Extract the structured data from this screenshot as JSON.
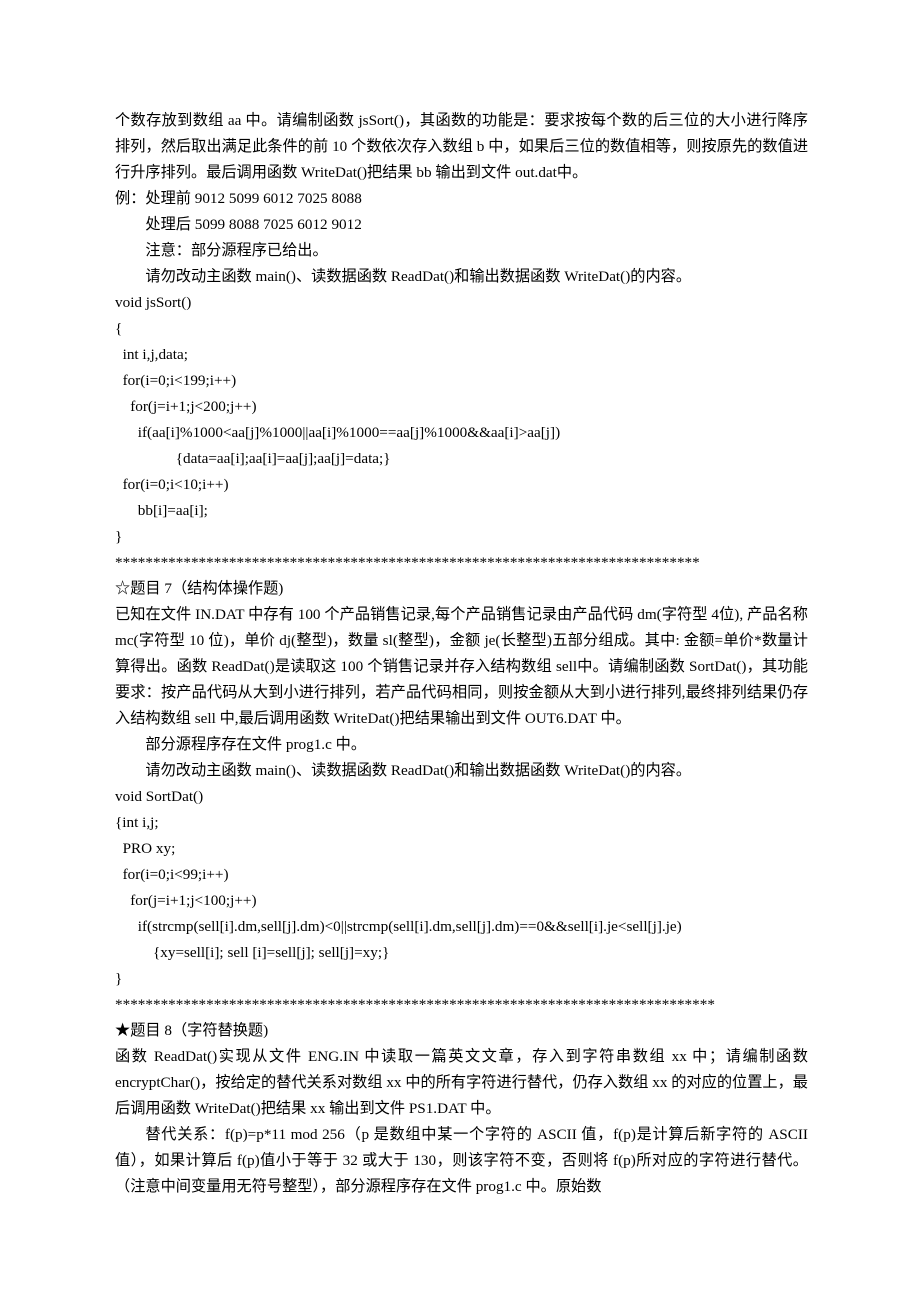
{
  "p_intro_1": "个数存放到数组 aa 中。请编制函数 jsSort()，其函数的功能是：要求按每个数的后三位的大小进行降序排列，然后取出满足此条件的前 10 个数依次存入数组 b 中，如果后三位的数值相等，则按原先的数值进行升序排列。最后调用函数 WriteDat()把结果 bb 输出到文件 out.dat中。",
  "p_example_line1": "例：处理前  9012 5099 6012 7025 8088",
  "p_example_line2": "处理后  5099 8088 7025 6012 9012",
  "p_note1": "注意：部分源程序已给出。",
  "p_note2": "请勿改动主函数 main()、读数据函数 ReadDat()和输出数据函数 WriteDat()的内容。",
  "code_block_1": "void jsSort()\n{\n  int i,j,data;\n  for(i=0;i<199;i++)\n    for(j=i+1;j<200;j++)\n      if(aa[i]%1000<aa[j]%1000||aa[i]%1000==aa[j]%1000&&aa[i]>aa[j])\n                {data=aa[i];aa[i]=aa[j];aa[j]=data;}\n  for(i=0;i<10;i++)\n      bb[i]=aa[i];\n}",
  "sep_1": "*****************************************************************************",
  "title_7": "☆题目 7（结构体操作题)",
  "p7_body": "已知在文件 IN.DAT 中存有 100 个产品销售记录,每个产品销售记录由产品代码 dm(字符型 4位), 产品名称 mc(字符型 10 位)，单价 dj(整型)，数量 sl(整型)，金额 je(长整型)五部分组成。其中: 金额=单价*数量计算得出。函数 ReadDat()是读取这 100 个销售记录并存入结构数组 sell中。请编制函数 SortDat()，其功能要求：按产品代码从大到小进行排列，若产品代码相同，则按金额从大到小进行排列,最终排列结果仍存入结构数组 sell 中,最后调用函数 WriteDat()把结果输出到文件 OUT6.DAT 中。",
  "p7_note1": "部分源程序存在文件 prog1.c 中。",
  "p7_note2": "请勿改动主函数 main()、读数据函数 ReadDat()和输出数据函数 WriteDat()的内容。",
  "code_block_2": "void SortDat()\n{int i,j;\n  PRO xy;\n  for(i=0;i<99;i++)\n    for(j=i+1;j<100;j++)\n      if(strcmp(sell[i].dm,sell[j].dm)<0||strcmp(sell[i].dm,sell[j].dm)==0&&sell[i].je<sell[j].je)\n          {xy=sell[i]; sell [i]=sell[j]; sell[j]=xy;}\n}",
  "sep_2": "*******************************************************************************",
  "title_8": "★题目 8（字符替换题)",
  "p8_body": "函数 ReadDat()实现从文件 ENG.IN 中读取一篇英文文章，存入到字符串数组 xx 中；请编制函数 encryptChar()，按给定的替代关系对数组 xx 中的所有字符进行替代，仍存入数组 xx 的对应的位置上，最后调用函数 WriteDat()把结果 xx 输出到文件 PS1.DAT 中。",
  "p8_rule": "替代关系：f(p)=p*11 mod 256（p 是数组中某一个字符的 ASCII 值，f(p)是计算后新字符的 ASCII 值），如果计算后 f(p)值小于等于 32 或大于 130，则该字符不变，否则将 f(p)所对应的字符进行替代。（注意中间变量用无符号整型），部分源程序存在文件 prog1.c 中。原始数"
}
